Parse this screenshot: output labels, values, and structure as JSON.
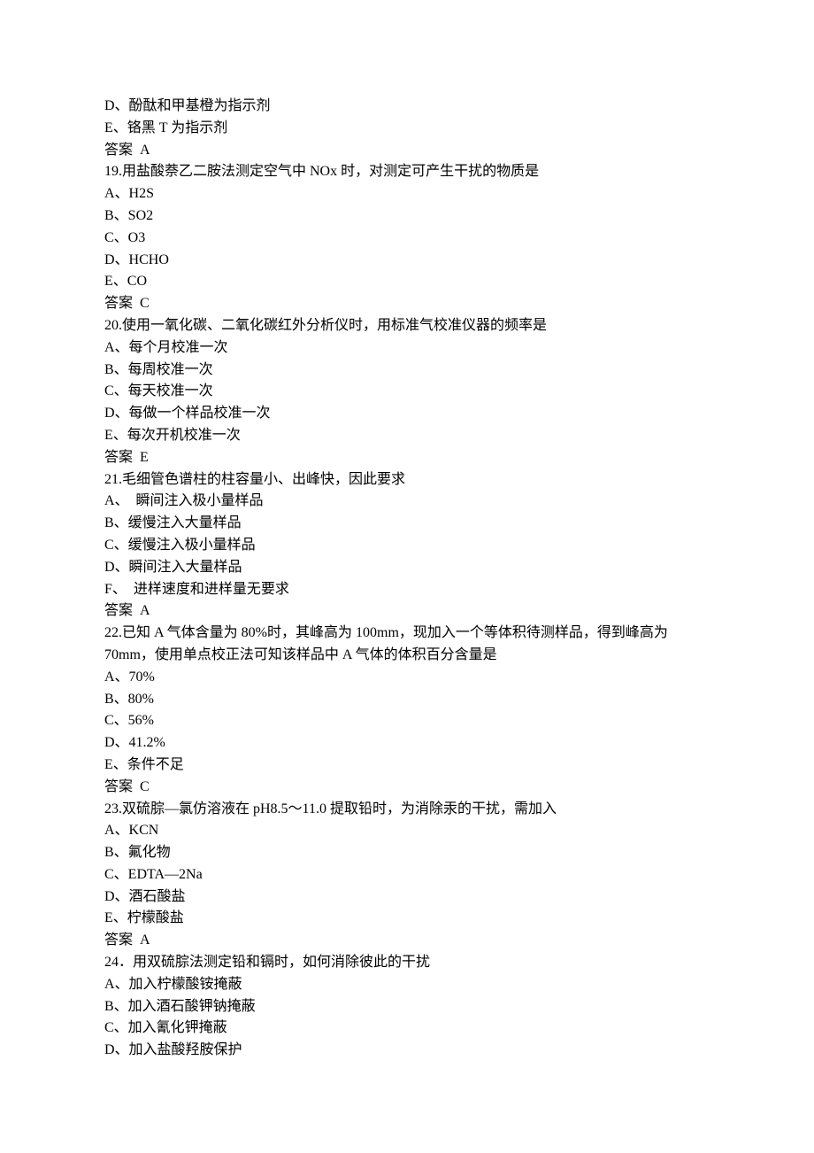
{
  "lines": [
    "D、酚酞和甲基橙为指示剂",
    "E、铬黑 T 为指示剂",
    "答案  A",
    "19.用盐酸萘乙二胺法测定空气中 NOx 时，对测定可产生干扰的物质是",
    "A、H2S",
    "B、SO2",
    "C、O3",
    "D、HCHO",
    "E、CO",
    "答案  C",
    "20.使用一氧化碳、二氧化碳红外分析仪时，用标准气校准仪器的频率是",
    "A、每个月校准一次",
    "B、每周校准一次",
    "C、每天校准一次",
    "D、每做一个样品校准一次",
    "E、每次开机校准一次",
    "答案  E",
    "21.毛细管色谱柱的柱容量小、出峰快，因此要求",
    "A、  瞬间注入极小量样品",
    "B、缓慢注入大量样品",
    "C、缓慢注入极小量样品",
    "D、瞬间注入大量样品",
    "F、  进样速度和进样量无要求",
    "答案  A",
    "22.已知 A 气体含量为 80%时，其峰高为 100mm，现加入一个等体积待测样品，得到峰高为",
    "70mm，使用单点校正法可知该样品中 A 气体的体积百分含量是",
    "A、70%",
    "B、80%",
    "C、56%",
    "D、41.2%",
    "E、条件不足",
    "答案  C",
    "23.双硫腙—氯仿溶液在 pH8.5～11.0 提取铅时，为消除汞的干扰，需加入",
    "A、KCN",
    "B、氟化物",
    "C、EDTA—2Na",
    "D、酒石酸盐",
    "E、柠檬酸盐",
    "答案  A",
    "24．用双硫腙法测定铅和镉时，如何消除彼此的干扰",
    "A、加入柠檬酸铵掩蔽",
    "B、加入酒石酸钾钠掩蔽",
    "C、加入氰化钾掩蔽",
    "D、加入盐酸羟胺保护"
  ]
}
